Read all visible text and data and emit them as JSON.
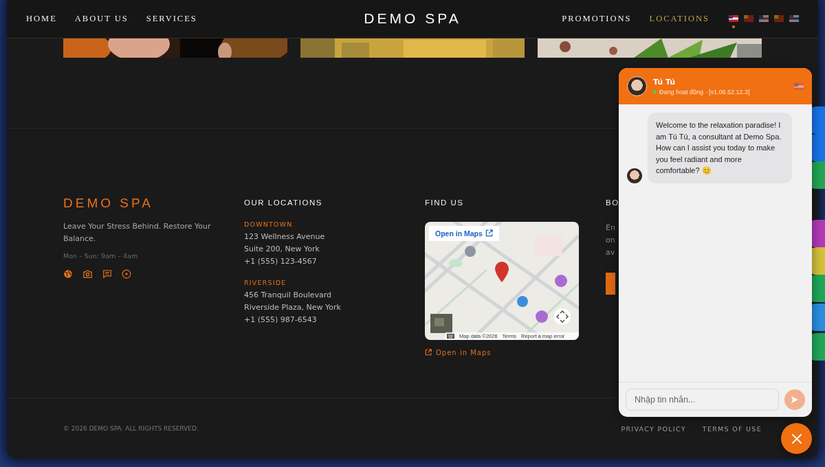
{
  "nav": {
    "left": [
      {
        "label": "HOME",
        "selected": false
      },
      {
        "label": "ABOUT US",
        "selected": false
      },
      {
        "label": "SERVICES",
        "selected": false
      }
    ],
    "brand": "DEMO SPA",
    "right": [
      {
        "label": "PROMOTIONS",
        "selected": false
      },
      {
        "label": "LOCATIONS",
        "selected": true
      }
    ],
    "languages": [
      {
        "selected": true
      },
      {
        "selected": false
      },
      {
        "selected": false
      },
      {
        "selected": false
      },
      {
        "selected": false
      }
    ]
  },
  "footer": {
    "brand": {
      "logo": "DEMO SPA",
      "tagline": "Leave Your Stress Behind. Restore Your Balance.",
      "hours": "Mon – Sun: 9am – 4am"
    },
    "locations": {
      "heading": "OUR LOCATIONS",
      "items": [
        {
          "name": "DOWNTOWN",
          "lines": [
            "123 Wellness Avenue",
            "Suite 200, New York",
            "+1 (555) 123-4567"
          ]
        },
        {
          "name": "RIVERSIDE",
          "lines": [
            "456 Tranquil Boulevard",
            "Riverside Plaza, New York",
            "+1 (555) 987-6543"
          ]
        }
      ]
    },
    "find_us": {
      "heading": "FIND US",
      "map": {
        "open_button": "Open in Maps",
        "attribution": [
          "Map data ©2026",
          "Terms",
          "Report a map error"
        ]
      },
      "link": "Open in Maps"
    },
    "column_4": {
      "heading": "BO",
      "lines": [
        "En",
        "on",
        "av"
      ]
    }
  },
  "bottom": {
    "copyright": "© 2026 DEMO SPA. ALL RIGHTS RESERVED.",
    "links": [
      "PRIVACY POLICY",
      "TERMS OF USE"
    ]
  },
  "side_buttons": [
    {
      "color": "#1a73e8"
    },
    {
      "color": "#1a73e8"
    },
    {
      "color": "#22a755"
    },
    {
      "color": "#b03ab8"
    },
    {
      "color": "#d4c23a"
    },
    {
      "color": "#1fa85a"
    },
    {
      "color": "#2a8fe0"
    },
    {
      "color": "#1fa85a"
    }
  ],
  "chat": {
    "agent": "Tú Tú",
    "status": "Đang hoạt động · [v1.06.52.12.3]",
    "online": true,
    "messages": [
      {
        "text": "Welcome to the relaxation paradise! I am Tú Tú, a consultant at Demo Spa. How can I assist you today to make you feel radiant and more comfortable? 😊"
      }
    ],
    "input": {
      "placeholder": "Nhập tin nhắn..."
    },
    "send_disabled": true
  }
}
